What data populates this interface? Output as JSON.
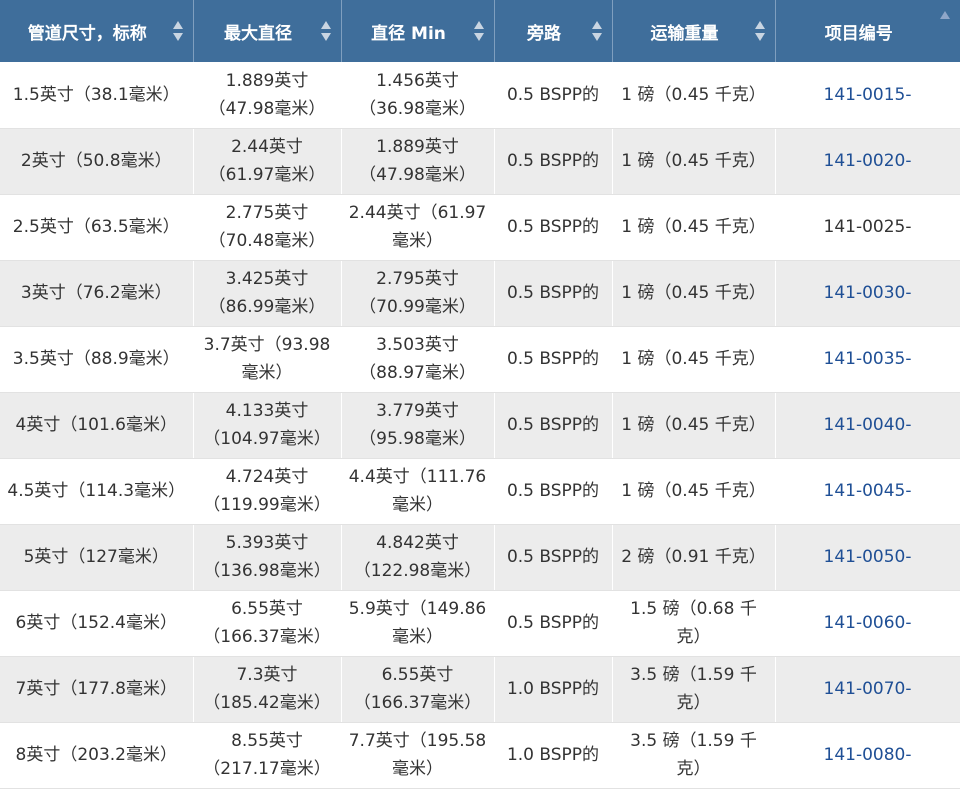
{
  "table": {
    "headers": [
      "管道尺寸，标称",
      "最大直径",
      "直径 Min",
      "旁路",
      "运输重量",
      "项目编号"
    ],
    "rows": [
      {
        "size": "1.5英寸（38.1毫米）",
        "max": "1.889英寸（47.98毫米）",
        "min": "1.456英寸（36.98毫米）",
        "bypass": "0.5 BSPP的",
        "weight": "1 磅（0.45 千克）",
        "item": "141-0015-",
        "item_link": true
      },
      {
        "size": "2英寸（50.8毫米）",
        "max": "2.44英寸（61.97毫米）",
        "min": "1.889英寸（47.98毫米）",
        "bypass": "0.5 BSPP的",
        "weight": "1 磅（0.45 千克）",
        "item": "141-0020-",
        "item_link": true
      },
      {
        "size": "2.5英寸（63.5毫米）",
        "max": "2.775英寸（70.48毫米）",
        "min": "2.44英寸（61.97毫米）",
        "bypass": "0.5 BSPP的",
        "weight": "1 磅（0.45 千克）",
        "item": "141-0025-",
        "item_link": false
      },
      {
        "size": "3英寸（76.2毫米）",
        "max": "3.425英寸（86.99毫米）",
        "min": "2.795英寸（70.99毫米）",
        "bypass": "0.5 BSPP的",
        "weight": "1 磅（0.45 千克）",
        "item": "141-0030-",
        "item_link": true
      },
      {
        "size": "3.5英寸（88.9毫米）",
        "max": "3.7英寸（93.98毫米）",
        "min": "3.503英寸（88.97毫米）",
        "bypass": "0.5 BSPP的",
        "weight": "1 磅（0.45 千克）",
        "item": "141-0035-",
        "item_link": true
      },
      {
        "size": "4英寸（101.6毫米）",
        "max": "4.133英寸（104.97毫米）",
        "min": "3.779英寸（95.98毫米）",
        "bypass": "0.5 BSPP的",
        "weight": "1 磅（0.45 千克）",
        "item": "141-0040-",
        "item_link": true
      },
      {
        "size": "4.5英寸（114.3毫米）",
        "max": "4.724英寸（119.99毫米）",
        "min": "4.4英寸（111.76毫米）",
        "bypass": "0.5 BSPP的",
        "weight": "1 磅（0.45 千克）",
        "item": "141-0045-",
        "item_link": true
      },
      {
        "size": "5英寸（127毫米）",
        "max": "5.393英寸（136.98毫米）",
        "min": "4.842英寸（122.98毫米）",
        "bypass": "0.5 BSPP的",
        "weight": "2 磅（0.91 千克）",
        "item": "141-0050-",
        "item_link": true
      },
      {
        "size": "6英寸（152.4毫米）",
        "max": "6.55英寸（166.37毫米）",
        "min": "5.9英寸（149.86毫米）",
        "bypass": "0.5 BSPP的",
        "weight": "1.5 磅（0.68 千克）",
        "item": "141-0060-",
        "item_link": true
      },
      {
        "size": "7英寸（177.8毫米）",
        "max": "7.3英寸（185.42毫米）",
        "min": "6.55英寸（166.37毫米）",
        "bypass": "1.0 BSPP的",
        "weight": "3.5 磅（1.59 千克）",
        "item": "141-0070-",
        "item_link": true
      },
      {
        "size": "8英寸（203.2毫米）",
        "max": "8.55英寸（217.17毫米）",
        "min": "7.7英寸（195.58毫米）",
        "bypass": "1.0 BSPP的",
        "weight": "3.5 磅（1.59 千克）",
        "item": "141-0080-",
        "item_link": true
      }
    ]
  },
  "colors": {
    "header_bg": "#3f6e9b",
    "header_text": "#ffffff",
    "row_alt_bg": "#ececec",
    "link": "#1f4f95",
    "text": "#333333"
  }
}
